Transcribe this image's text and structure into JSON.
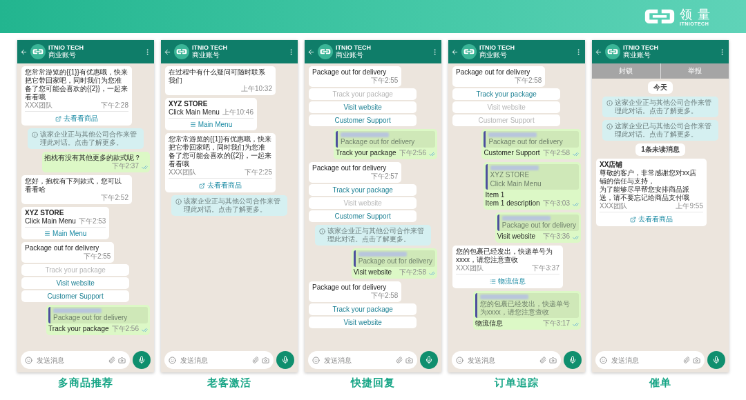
{
  "brand": {
    "name": "领量",
    "subname": "ITNIOTECH"
  },
  "phones": [
    {
      "header": {
        "name": "ITNIO TECH",
        "subtitle": "商业账号"
      },
      "input_placeholder": "发送消息",
      "caption": "多商品推荐",
      "messages": [
        {
          "kind": "incoming",
          "paragraphs": [
            "您常常游览的{{1}}有优惠哦，快来把它带回家吧，同时我们为您准备了您可能会喜欢的{{2}}，一起来看看哦"
          ],
          "footer": "XXX团队",
          "time": "下午2:28",
          "action": {
            "kind": "url",
            "label": "去看看商品"
          }
        },
        {
          "kind": "notice",
          "text": "该家企业正与其他公司合作来管理此对话。点击了解更多。"
        },
        {
          "kind": "outgoing",
          "lines": [
            "抱枕有没有其他更多的款式呢？"
          ],
          "time": "下午2:37"
        },
        {
          "kind": "incoming",
          "paragraphs": [
            "您好，抱枕有下列款式，您可以看看哈"
          ],
          "time": "下午2:52"
        },
        {
          "kind": "incoming",
          "title": "XYZ STORE",
          "paragraphs": [
            "Click Main Menu"
          ],
          "time": "下午2:53",
          "action": {
            "kind": "menu",
            "label": "Main Menu"
          }
        },
        {
          "kind": "buttons",
          "text": "Package out for delivery",
          "time": "下午2:55",
          "buttons": [
            {
              "label": "Track your package",
              "disabled": true
            },
            {
              "label": "Visit website",
              "disabled": false
            },
            {
              "label": "Customer Support",
              "disabled": false
            }
          ]
        },
        {
          "kind": "reply",
          "quote": [
            "Package out for delivery"
          ],
          "lines": [
            "Track your package"
          ],
          "time": "下午2:56"
        }
      ]
    },
    {
      "header": {
        "name": "ITNIO TECH",
        "subtitle": "商业账号"
      },
      "input_placeholder": "发送消息",
      "caption": "老客激活",
      "messages": [
        {
          "kind": "incoming",
          "paragraphs": [
            "在过程中有什么疑问可随时联系我们"
          ],
          "time": "上午10:32"
        },
        {
          "kind": "incoming",
          "title": "XYZ STORE",
          "paragraphs": [
            "Click Main Menu"
          ],
          "time": "上午10:46",
          "action": {
            "kind": "menu",
            "label": "Main Menu"
          }
        },
        {
          "kind": "incoming",
          "paragraphs": [
            "您常常游览的{{1}}有优惠哦，快来把它带回家吧，同时我们为您准备了您可能会喜欢的{{2}}，一起来看看哦"
          ],
          "footer": "XXX团队",
          "time": "下午2:25",
          "action": {
            "kind": "url",
            "label": "去看看商品"
          }
        },
        {
          "kind": "notice",
          "text": "该家企业正与其他公司合作来管理此对话。点击了解更多。"
        }
      ]
    },
    {
      "header": {
        "name": "ITNIO TECH",
        "subtitle": "商业账号"
      },
      "input_placeholder": "发送消息",
      "caption": "快捷回复",
      "messages": [
        {
          "kind": "buttons",
          "text": "Package out for delivery",
          "time": "下午2:55",
          "buttons": [
            {
              "label": "Track your package",
              "disabled": true
            },
            {
              "label": "Visit website",
              "disabled": false
            },
            {
              "label": "Customer Support",
              "disabled": false
            }
          ]
        },
        {
          "kind": "reply",
          "quote": [
            "Package out for delivery"
          ],
          "lines": [
            "Track your package"
          ],
          "time": "下午2:56"
        },
        {
          "kind": "buttons",
          "text": "Package out for delivery",
          "time": "下午2:57",
          "buttons": [
            {
              "label": "Track your package",
              "disabled": false
            },
            {
              "label": "Visit website",
              "disabled": true
            },
            {
              "label": "Customer Support",
              "disabled": false
            }
          ]
        },
        {
          "kind": "notice",
          "text": "该家企业正与其他公司合作来管理此对话。点击了解更多。"
        },
        {
          "kind": "reply",
          "quote": [
            "Package out for delivery"
          ],
          "lines": [
            "Visit website"
          ],
          "time": "下午2:58"
        },
        {
          "kind": "buttons",
          "text": "Package out for delivery",
          "time": "下午2:58",
          "buttons": [
            {
              "label": "Track your package",
              "disabled": false
            },
            {
              "label": "Visit website",
              "disabled": false
            }
          ]
        }
      ]
    },
    {
      "header": {
        "name": "ITNIO TECH",
        "subtitle": "商业账号"
      },
      "input_placeholder": "发送消息",
      "caption": "订单追踪",
      "messages": [
        {
          "kind": "buttons",
          "text": "Package out for delivery",
          "time": "下午2:58",
          "buttons": [
            {
              "label": "Track your package",
              "disabled": false
            },
            {
              "label": "Visit website",
              "disabled": true
            },
            {
              "label": "Customer Support",
              "disabled": true
            }
          ]
        },
        {
          "kind": "reply",
          "quote": [
            "Package out for delivery"
          ],
          "lines": [
            "Customer Support"
          ],
          "time": "下午2:58"
        },
        {
          "kind": "reply",
          "quote": [
            "XYZ STORE",
            "Click Main Menu"
          ],
          "lines": [
            "Item 1",
            "Item 1 description"
          ],
          "time": "下午3:03"
        },
        {
          "kind": "reply",
          "quote": [
            "Package out for delivery"
          ],
          "lines": [
            "Visit website"
          ],
          "time": "下午3:36"
        },
        {
          "kind": "incoming",
          "paragraphs": [
            "您的包裹已经发出，快递单号为xxxx，请您注意查收"
          ],
          "footer": "XXX团队",
          "time": "下午3:37",
          "action": {
            "kind": "list",
            "label": "物流信息"
          }
        },
        {
          "kind": "reply",
          "quote": [
            "您的包裹已经发出，快递单号为xxxx，请您注意查收"
          ],
          "lines": [
            "物流信息"
          ],
          "time": "下午3:17"
        }
      ]
    },
    {
      "header": {
        "name": "ITNIO TECH",
        "subtitle": "商业账号"
      },
      "input_placeholder": "发送消息",
      "caption": "催单",
      "top_actions": [
        "封锁",
        "举报"
      ],
      "messages": [
        {
          "kind": "date",
          "text": "今天"
        },
        {
          "kind": "notice",
          "text": "这家企业正与其他公司合作来管理此对话。点击了解更多。"
        },
        {
          "kind": "notice",
          "text": "这家企业已与其他公司合作来管理此对话。点击了解更多。"
        },
        {
          "kind": "date",
          "text": "1条未读消息"
        },
        {
          "kind": "incoming",
          "title": "XX店铺",
          "paragraphs": [
            "尊敬的客户，非常感谢您对xx店铺的信任与支持，",
            "为了能够尽早帮您安排商品派送，请不要忘记给商品支付哦"
          ],
          "footer": "XXX团队",
          "time": "上午9:55",
          "action": {
            "kind": "url",
            "label": "去看看商品"
          }
        }
      ]
    }
  ]
}
